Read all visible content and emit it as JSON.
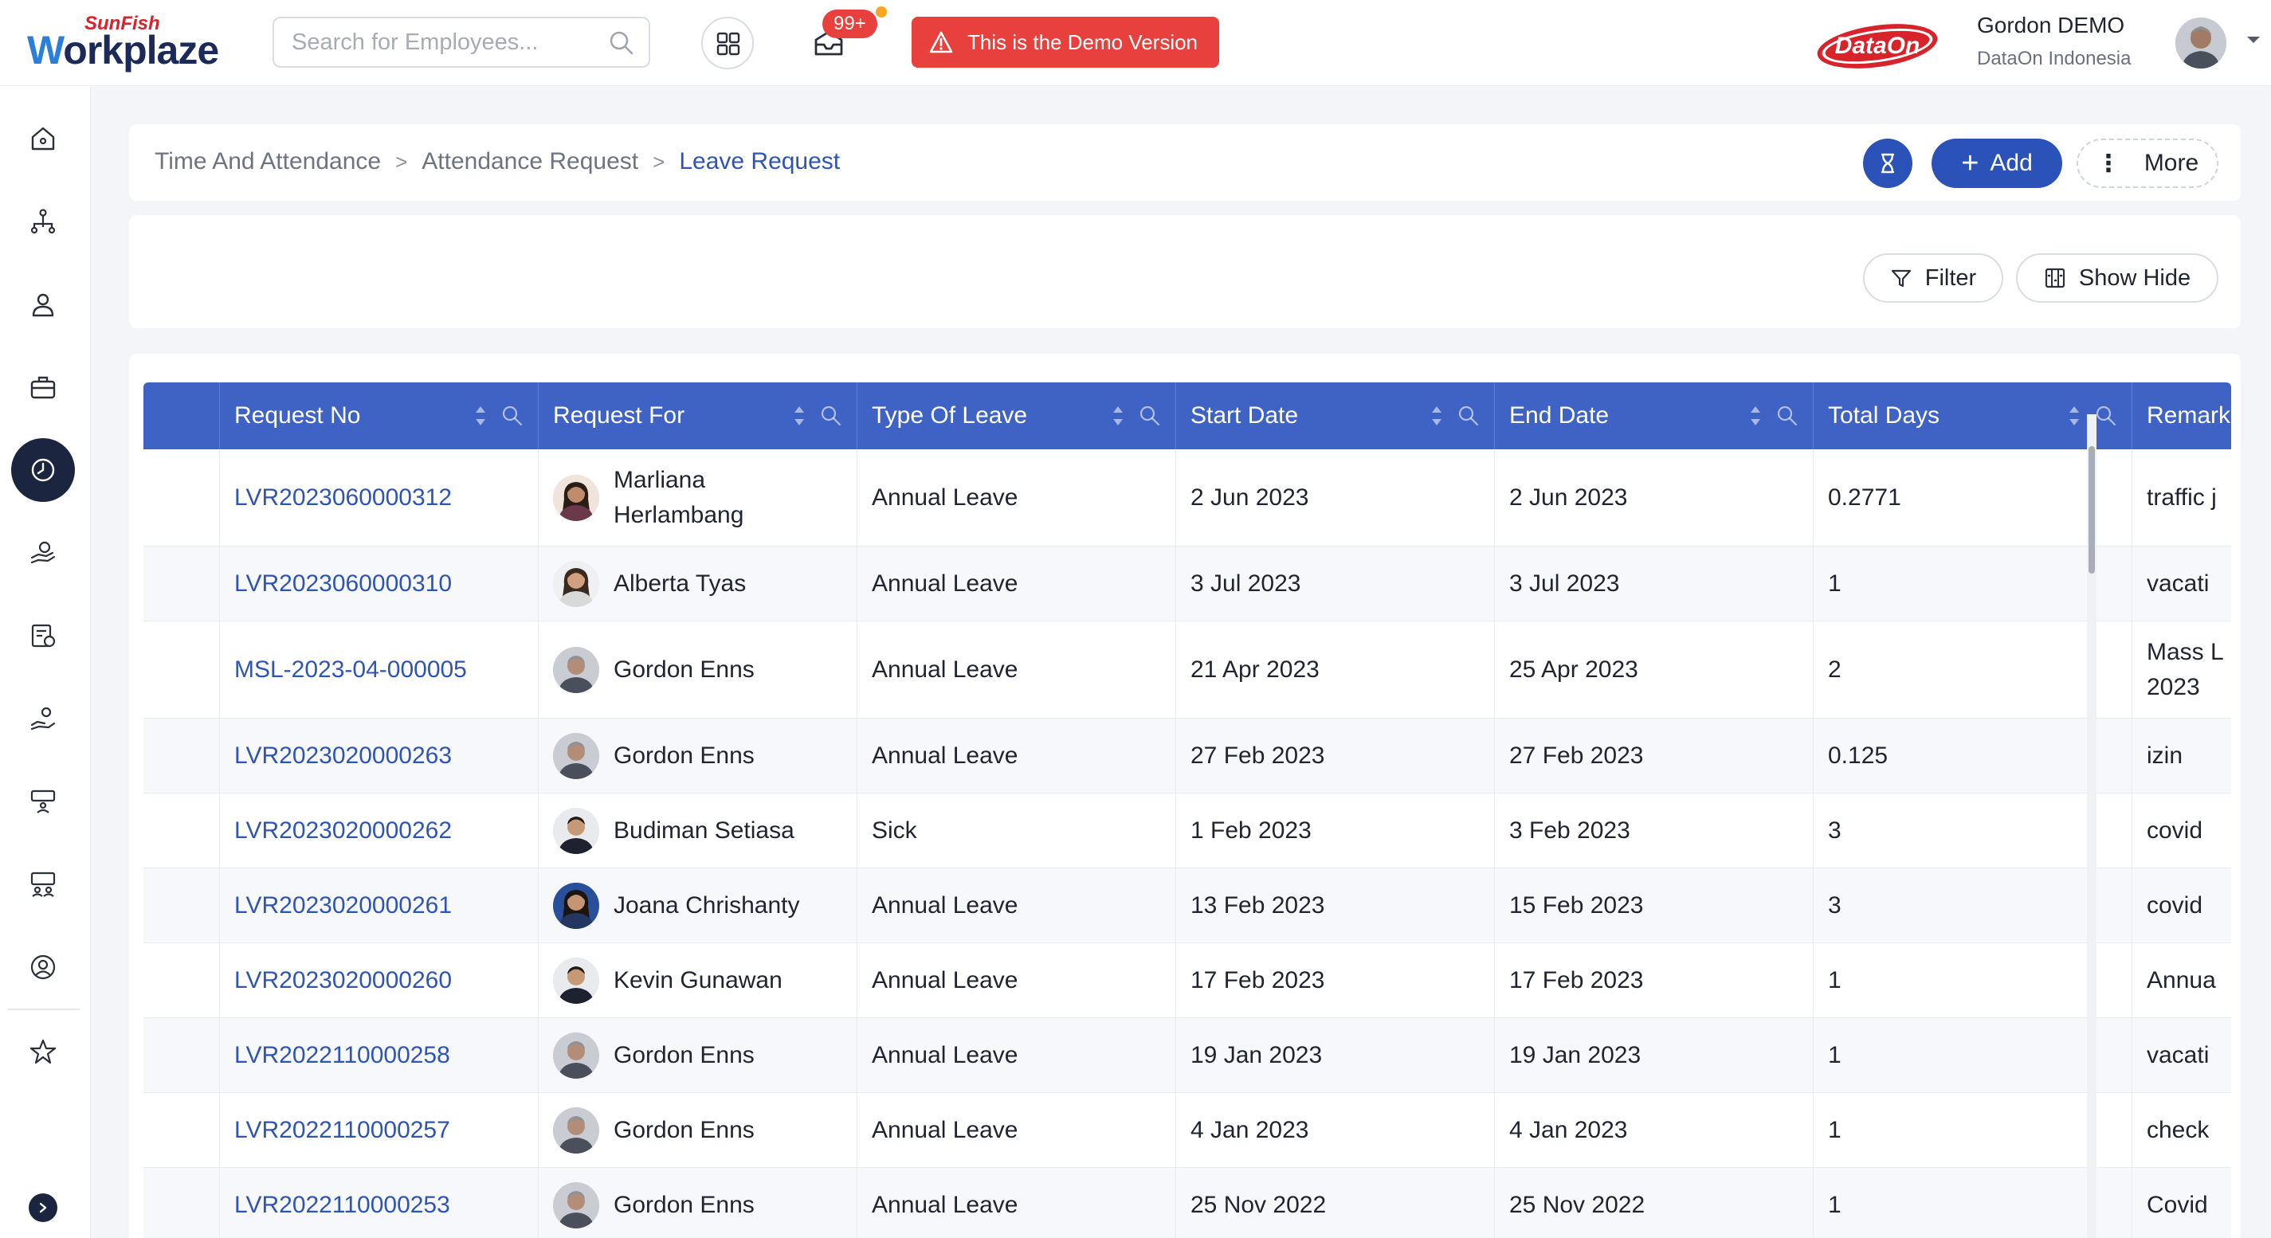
{
  "brand": {
    "top": "SunFish",
    "main_w": "W",
    "main_rest": "orkplaze"
  },
  "search": {
    "placeholder": "Search for Employees..."
  },
  "notifications": {
    "badge": "99+"
  },
  "demo_banner": {
    "text": "This is the Demo Version"
  },
  "partner_logo": {
    "text": "DataOn"
  },
  "user": {
    "name": "Gordon DEMO",
    "company": "DataOn Indonesia"
  },
  "breadcrumb": {
    "items": [
      "Time And Attendance",
      "Attendance Request"
    ],
    "current": "Leave Request"
  },
  "actions": {
    "add_label": "Add",
    "more_label": "More"
  },
  "filters": {
    "filter_label": "Filter",
    "show_hide_label": "Show Hide"
  },
  "colors": {
    "primary": "#2b52b8",
    "header": "#3f63c4",
    "danger": "#e7403d",
    "nav_active": "#1c2540"
  },
  "sidebar": {
    "items": [
      "home-icon",
      "org-chart-icon",
      "employee-icon",
      "briefcase-icon",
      "clock-icon",
      "hand-coins-icon",
      "payroll-icon",
      "benefit-icon",
      "training-icon",
      "recruitment-icon",
      "profile-icon",
      "star-icon"
    ],
    "active": "clock-icon"
  },
  "table": {
    "columns": [
      "Request No",
      "Request For",
      "Type Of Leave",
      "Start Date",
      "End Date",
      "Total Days",
      "Remark"
    ],
    "rows": [
      {
        "no": "LVR2023060000312",
        "for_line1": "Marliana",
        "for_line2": "Herlambang",
        "type": "Annual Leave",
        "start": "2 Jun 2023",
        "end": "2 Jun 2023",
        "days": "0.2771",
        "remark": "traffic j",
        "remark2": "",
        "avatar": "female"
      },
      {
        "no": "LVR2023060000310",
        "for_line1": "Alberta Tyas",
        "for_line2": "",
        "type": "Annual Leave",
        "start": "3 Jul 2023",
        "end": "3 Jul 2023",
        "days": "1",
        "remark": "vacati",
        "remark2": "",
        "avatar": "female2"
      },
      {
        "no": "MSL-2023-04-000005",
        "for_line1": "Gordon Enns",
        "for_line2": "",
        "type": "Annual Leave",
        "start": "21 Apr 2023",
        "end": "25 Apr 2023",
        "days": "2",
        "remark": "Mass L",
        "remark2": "2023",
        "avatar": "male"
      },
      {
        "no": "LVR2023020000263",
        "for_line1": "Gordon Enns",
        "for_line2": "",
        "type": "Annual Leave",
        "start": "27 Feb 2023",
        "end": "27 Feb 2023",
        "days": "0.125",
        "remark": "izin",
        "remark2": "",
        "avatar": "male"
      },
      {
        "no": "LVR2023020000262",
        "for_line1": "Budiman Setiasa",
        "for_line2": "",
        "type": "Sick",
        "start": "1 Feb 2023",
        "end": "3 Feb 2023",
        "days": "3",
        "remark": "covid",
        "remark2": "",
        "avatar": "male2"
      },
      {
        "no": "LVR2023020000261",
        "for_line1": "Joana Chrishanty",
        "for_line2": "",
        "type": "Annual Leave",
        "start": "13 Feb 2023",
        "end": "15 Feb 2023",
        "days": "3",
        "remark": "covid",
        "remark2": "",
        "avatar": "female3"
      },
      {
        "no": "LVR2023020000260",
        "for_line1": "Kevin Gunawan",
        "for_line2": "",
        "type": "Annual Leave",
        "start": "17 Feb 2023",
        "end": "17 Feb 2023",
        "days": "1",
        "remark": "Annua",
        "remark2": "",
        "avatar": "male2"
      },
      {
        "no": "LVR2022110000258",
        "for_line1": "Gordon Enns",
        "for_line2": "",
        "type": "Annual Leave",
        "start": "19 Jan 2023",
        "end": "19 Jan 2023",
        "days": "1",
        "remark": "vacati",
        "remark2": "",
        "avatar": "male"
      },
      {
        "no": "LVR2022110000257",
        "for_line1": "Gordon Enns",
        "for_line2": "",
        "type": "Annual Leave",
        "start": "4 Jan 2023",
        "end": "4 Jan 2023",
        "days": "1",
        "remark": "check",
        "remark2": "",
        "avatar": "male"
      },
      {
        "no": "LVR2022110000253",
        "for_line1": "Gordon Enns",
        "for_line2": "",
        "type": "Annual Leave",
        "start": "25 Nov 2022",
        "end": "25 Nov 2022",
        "days": "1",
        "remark": "Covid",
        "remark2": "",
        "avatar": "male"
      }
    ]
  }
}
